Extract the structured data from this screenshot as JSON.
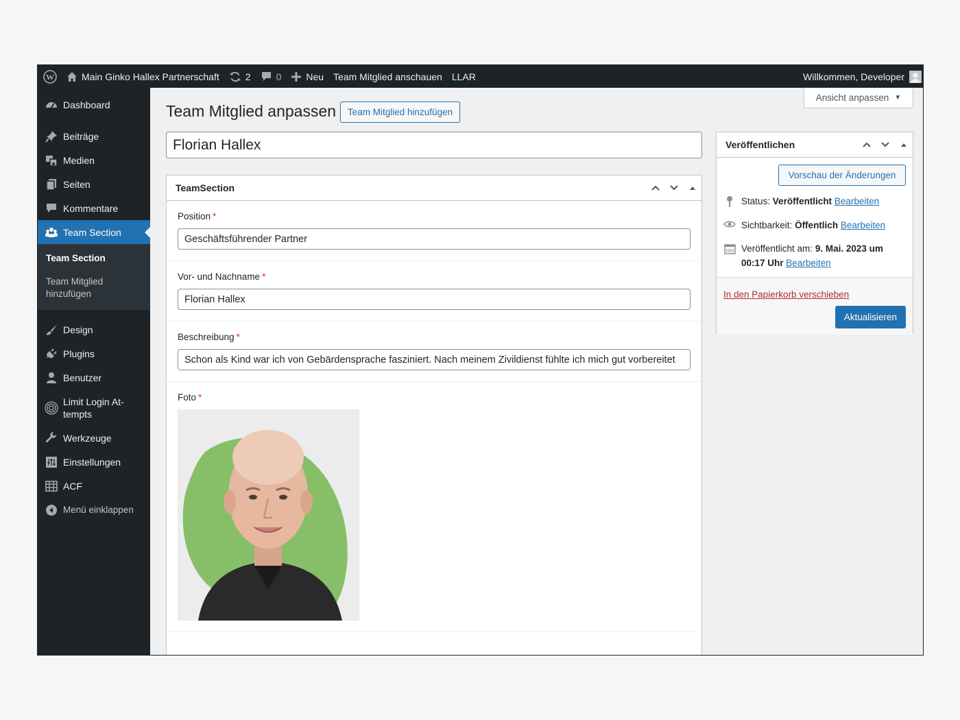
{
  "adminbar": {
    "site_name": "Main Ginko Hallex Partnerschaft",
    "updates_count": "2",
    "comments_count": "0",
    "new_label": "Neu",
    "view_label": "Team Mitglied anschauen",
    "llar_label": "LLAR",
    "greeting": "Willkommen, Developer"
  },
  "sidebar": {
    "items": [
      {
        "label": "Dashboard",
        "icon": "dashboard-icon"
      },
      {
        "label": "Beiträge",
        "icon": "pin-icon"
      },
      {
        "label": "Medien",
        "icon": "media-icon"
      },
      {
        "label": "Seiten",
        "icon": "pages-icon"
      },
      {
        "label": "Kommentare",
        "icon": "comment-icon"
      },
      {
        "label": "Team Section",
        "icon": "group-icon"
      },
      {
        "label": "Design",
        "icon": "brush-icon"
      },
      {
        "label": "Plugins",
        "icon": "plugin-icon"
      },
      {
        "label": "Benutzer",
        "icon": "user-icon"
      },
      {
        "label": "Limit Login At-tempts",
        "icon": "fingerprint-icon"
      },
      {
        "label": "Werkzeuge",
        "icon": "wrench-icon"
      },
      {
        "label": "Einstellungen",
        "icon": "settings-icon"
      },
      {
        "label": "ACF",
        "icon": "grid-icon"
      }
    ],
    "submenu": {
      "current": "Team Section",
      "add_new": "Team Mitglied hinzufügen"
    },
    "collapse_label": "Menü einklappen"
  },
  "screen_options": {
    "label": "Ansicht anpassen"
  },
  "header": {
    "title": "Team Mitglied anpassen",
    "add_new": "Team Mitglied hinzufügen"
  },
  "post_title": "Florian Hallex",
  "acf_box": {
    "title": "TeamSection",
    "fields": {
      "position": {
        "label": "Position",
        "value": "Geschäftsführender Partner"
      },
      "name": {
        "label": "Vor- und Nachname",
        "value": "Florian Hallex"
      },
      "description": {
        "label": "Beschreibung",
        "value": "Schon als Kind war ich von Gebärdensprache fasziniert. Nach meinem Zivildienst fühlte ich mich gut vorbereitet"
      },
      "photo": {
        "label": "Foto"
      }
    },
    "required_mark": "*"
  },
  "publish_box": {
    "title": "Veröffentlichen",
    "preview": "Vorschau der Änderungen",
    "status_label": "Status:",
    "status_value": "Veröffentlicht",
    "visibility_label": "Sichtbarkeit:",
    "visibility_value": "Öffentlich",
    "published_label": "Veröffentlicht am:",
    "published_value": "9. Mai. 2023 um 00:17 Uhr",
    "edit": "Bearbeiten",
    "trash": "In den Papierkorb verschieben",
    "update": "Aktualisieren"
  },
  "colors": {
    "admin_dark": "#1d2327",
    "accent": "#2271b1",
    "danger": "#b32d2e"
  }
}
